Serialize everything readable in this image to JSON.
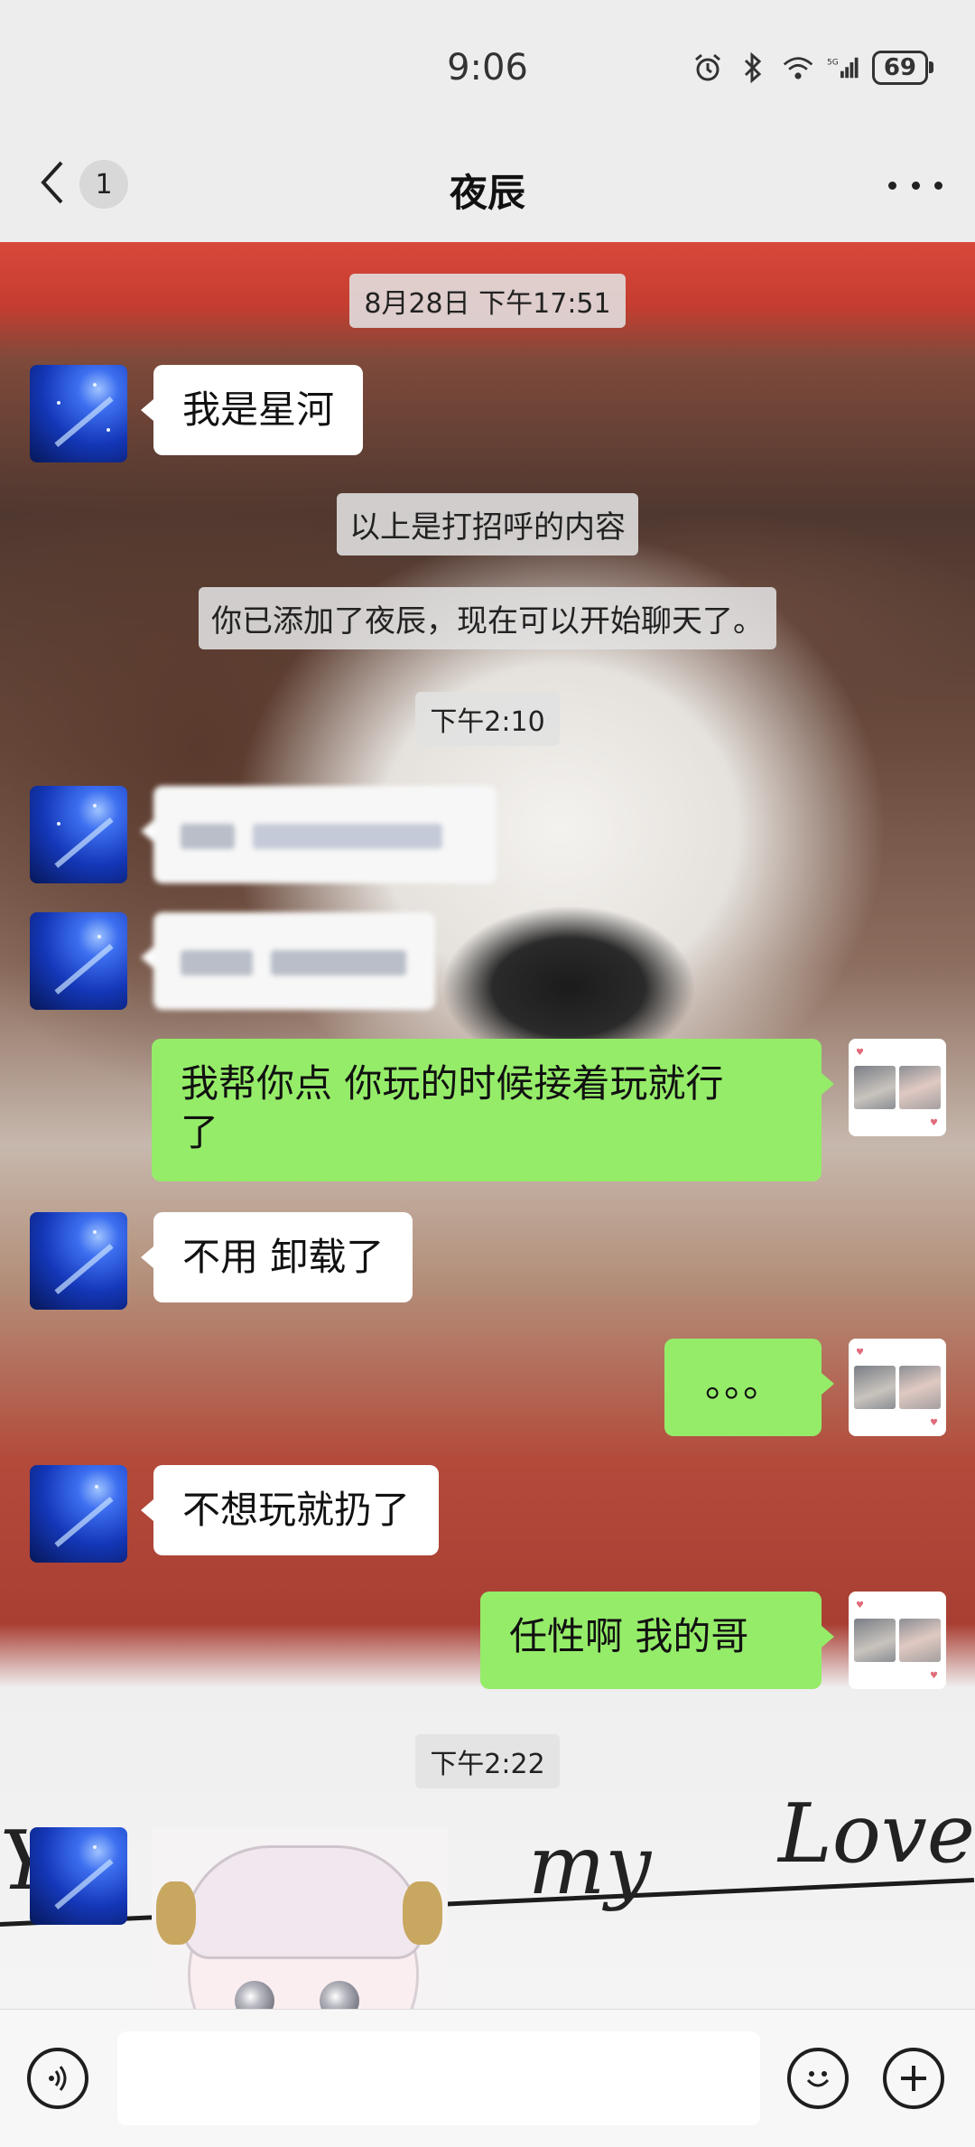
{
  "status_bar": {
    "time": "9:06",
    "battery": "69"
  },
  "header": {
    "back_count": "1",
    "title": "夜辰"
  },
  "messages": {
    "ts1": "8月28日 下午17:51",
    "m1": "我是星河",
    "sys1": "以上是打招呼的内容",
    "sys2": "你已添加了夜辰，现在可以开始聊天了。",
    "ts2": "下午2:10",
    "m4_line1": "我帮你点   你玩的时候接着玩就行",
    "m4_line2": "了",
    "m5": "不用 卸载了",
    "m6": "。。。",
    "m7": "不想玩就扔了",
    "m8": "任性啊   我的哥",
    "ts3": "下午2:22"
  },
  "background_text": {
    "w1": "Yo",
    "w2": "my",
    "w3": "Love"
  },
  "colors": {
    "outgoing_bubble": "#95ec69",
    "incoming_bubble": "#ffffff",
    "background": "#ededed"
  },
  "icons": {
    "back": "chevron-left-icon",
    "more": "more-dots-icon",
    "voice": "voice-icon",
    "emoji": "emoji-icon",
    "plus": "plus-icon"
  }
}
